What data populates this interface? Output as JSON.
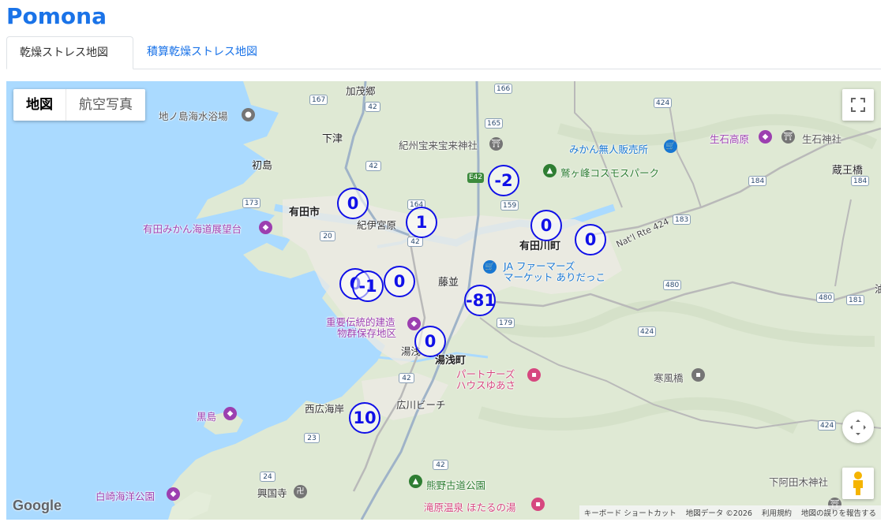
{
  "app": {
    "title": "Pomona"
  },
  "tabs": [
    {
      "label": "乾燥ストレス地図",
      "active": true
    },
    {
      "label": "積算乾燥ストレス地図",
      "active": false
    }
  ],
  "map": {
    "type_buttons": {
      "map": "地図",
      "satellite": "航空写真"
    },
    "places": {
      "kamosato": "加茂郷",
      "jinoshima": "地ノ島海水浴場",
      "shimotsu": "下津",
      "kishu_hosen": "紀州宝来宝来神社",
      "mikan_stand": "みかん無人販売所",
      "ikuishi_kogen": "生石高原",
      "ikuishi_shrine": "生石神社",
      "hatsushima": "初島",
      "washigamine": "鷲ヶ峰コスモスパーク",
      "zaocho": "蔵王橋",
      "arida_city": "有田市",
      "kii_miyahara": "紀伊宮原",
      "arida_view": "有田みかん海道展望台",
      "aridagawa_town": "有田川町",
      "natl_rte": "Nat'l Rte 424",
      "ja_farmers": "JA ファーマーズ",
      "ja_farmers2": "マーケット ありだっこ",
      "fujinami": "藤並",
      "juyo_line1": "重要伝統的建造",
      "juyo_line2": "物群保存地区",
      "yuasa_station": "湯浅",
      "yuasa_town": "湯浅町",
      "partners_line1": "パートナーズ",
      "partners_line2": "ハウスゆあさ",
      "kazafuki": "寒風橋",
      "nishihiro": "西広海岸",
      "hirokawa_beach": "広川ビーチ",
      "kuroshima": "黒島",
      "kumano_kodo": "熊野古道公園",
      "shirasaki": "白崎海洋公園",
      "kokokuji": "興国寺",
      "takihara": "滝原温泉 ほたるの湯",
      "shimoaida": "下阿田木神社",
      "edge_aburaga": "油"
    },
    "routes": {
      "r167": "167",
      "r166": "166",
      "r165": "165",
      "r164": "164",
      "r159": "159",
      "r424a": "424",
      "r424b": "424",
      "r424c": "424",
      "r184": "184",
      "r183": "183",
      "r173": "173",
      "r20": "20",
      "r42a": "42",
      "r42b": "42",
      "r42c": "42",
      "r42d": "42",
      "r42e": "42",
      "r179": "179",
      "r480a": "480",
      "r480b": "480",
      "r181": "181",
      "r23": "23",
      "r24": "24",
      "e42": "E42"
    },
    "markers": [
      {
        "value": "0"
      },
      {
        "value": "-2"
      },
      {
        "value": "1"
      },
      {
        "value": "0"
      },
      {
        "value": "0"
      },
      {
        "value": "0"
      },
      {
        "value": "-1"
      },
      {
        "value": "0"
      },
      {
        "value": "-81"
      },
      {
        "value": "0"
      },
      {
        "value": "10"
      }
    ],
    "logo": "Google",
    "attribution": {
      "shortcuts": "キーボード ショートカット",
      "data": "地図データ ©2026",
      "terms": "利用規約",
      "report": "地図の誤りを報告する"
    },
    "colors": {
      "water": "#aadaff",
      "land": "#dfe9d4",
      "urban": "#eceae4",
      "marker": "#1010e8"
    }
  }
}
